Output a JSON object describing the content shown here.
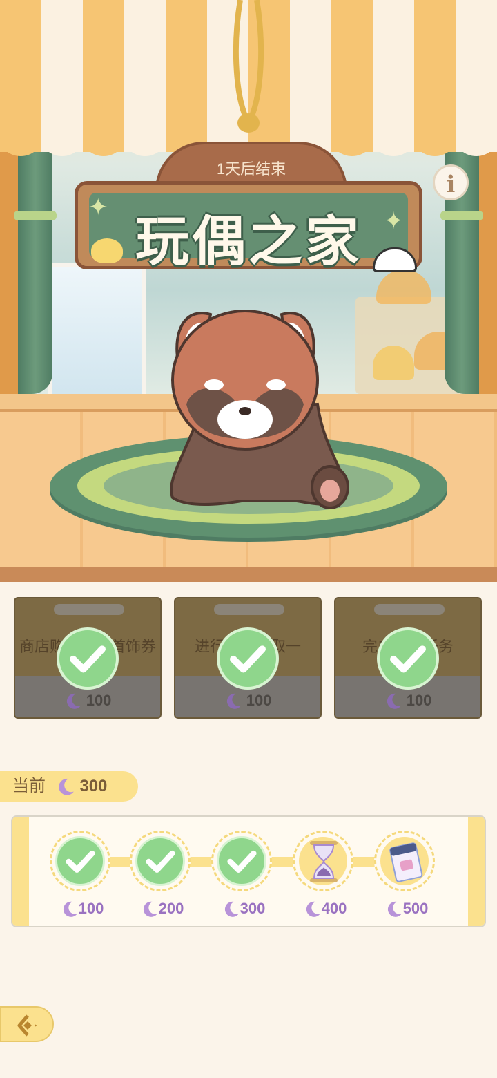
{
  "banner": {
    "countdown": "1天后结束",
    "title": "玩偶之家"
  },
  "tasks": [
    {
      "text": "商店购买高级首饰券",
      "reward": "100",
      "completed": true
    },
    {
      "text": "进行一次抽取一",
      "reward": "100",
      "completed": true
    },
    {
      "text": "完成日常任务",
      "reward": "100",
      "completed": true
    }
  ],
  "progress": {
    "label": "当前",
    "current": "300",
    "milestones": [
      {
        "value": "100",
        "claimed": true,
        "icon": "plush-icon"
      },
      {
        "value": "200",
        "claimed": true,
        "icon": "plush-icon"
      },
      {
        "value": "300",
        "claimed": true,
        "icon": "plush-icon"
      },
      {
        "value": "400",
        "claimed": false,
        "icon": "hourglass-icon"
      },
      {
        "value": "500",
        "claimed": false,
        "icon": "ticket-icon"
      }
    ]
  },
  "colors": {
    "accent_yellow": "#fbe18e",
    "check_green": "#8fd68c",
    "moon_purple": "#9a72c1"
  }
}
